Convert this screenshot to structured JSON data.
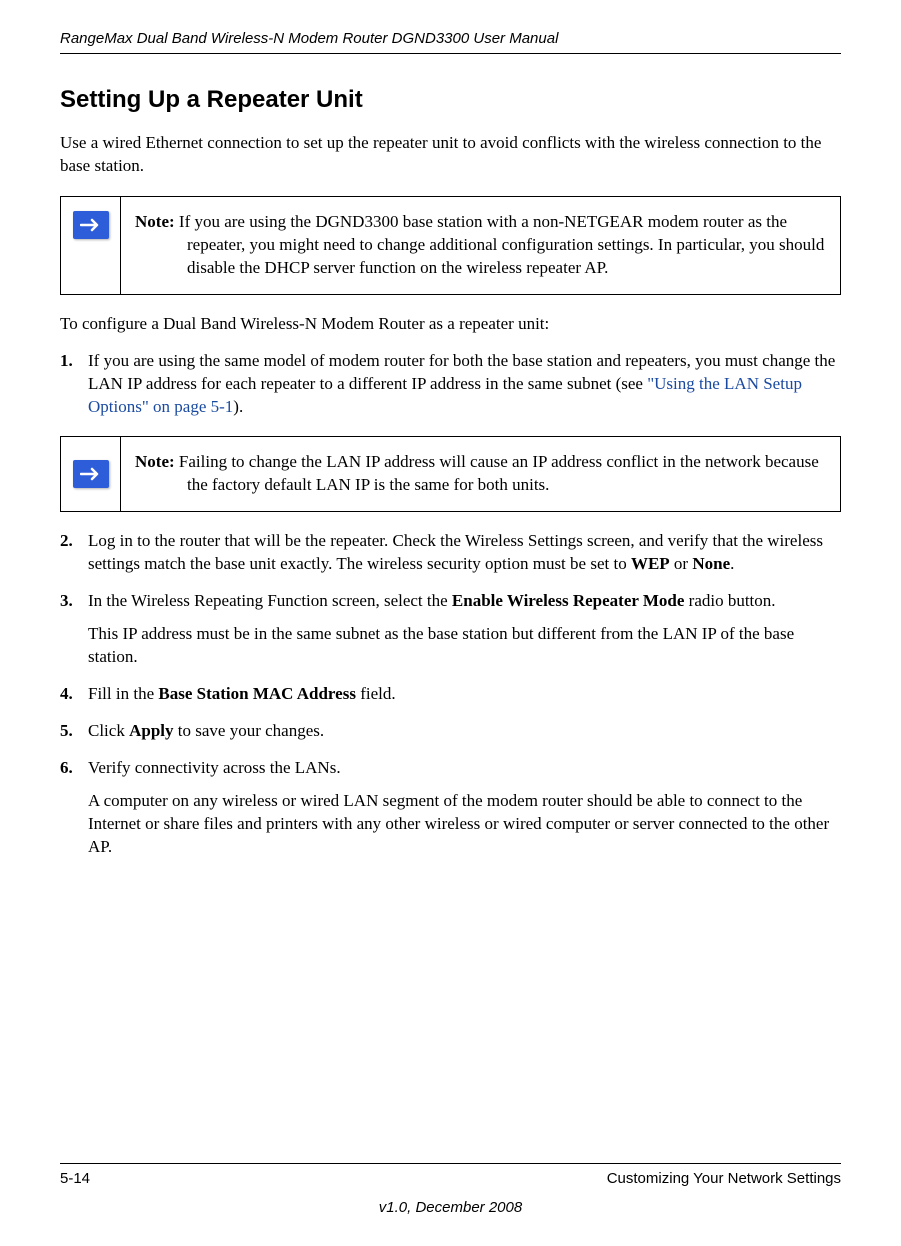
{
  "header": {
    "manual_title": "RangeMax Dual Band Wireless-N Modem Router DGND3300 User Manual"
  },
  "section": {
    "heading": "Setting Up a Repeater Unit",
    "intro": "Use a wired Ethernet connection to set up the repeater unit to avoid conflicts with the wireless connection to the base station."
  },
  "note1": {
    "label": "Note:",
    "text": " If you are using the DGND3300 base station with a non-NETGEAR modem router as the repeater, you might need to change additional configuration settings. In particular, you should disable the DHCP server function on the wireless repeater AP."
  },
  "lead_in": "To configure a Dual Band Wireless-N Modem Router as a repeater unit:",
  "steps": {
    "s1_a": "If you are using the same model of modem router for both the base station and repeaters, you must change the LAN IP address for each repeater to a different IP address in the same subnet (see ",
    "s1_link": "\"Using the LAN Setup Options\" on page 5-1",
    "s1_b": ").",
    "s2_a": "Log in to the router that will be the repeater. Check the Wireless Settings screen, and verify that the wireless settings match the base unit exactly. The wireless security option must be set to ",
    "s2_bold1": "WEP",
    "s2_or": " or ",
    "s2_bold2": "None",
    "s2_end": ".",
    "s3_a": "In the Wireless Repeating Function screen, select the ",
    "s3_bold": "Enable Wireless Repeater Mode",
    "s3_b": " radio button.",
    "s3_sub": "This IP address must be in the same subnet as the base station but different from the LAN IP of the base station.",
    "s4_a": "Fill in the ",
    "s4_bold": "Base Station MAC Address",
    "s4_b": " field.",
    "s5_a": "Click ",
    "s5_bold": "Apply",
    "s5_b": " to save your changes.",
    "s6_a": "Verify connectivity across the LANs.",
    "s6_sub": "A computer on any wireless or wired LAN segment of the modem router should be able to connect to the Internet or share files and printers with any other wireless or wired computer or server connected to the other AP."
  },
  "note2": {
    "label": "Note:",
    "text": " Failing to change the LAN IP address will cause an IP address conflict in the network because the factory default LAN IP is the same for both units."
  },
  "footer": {
    "page_num": "5-14",
    "chapter": "Customizing Your Network Settings",
    "version": "v1.0, December 2008"
  }
}
